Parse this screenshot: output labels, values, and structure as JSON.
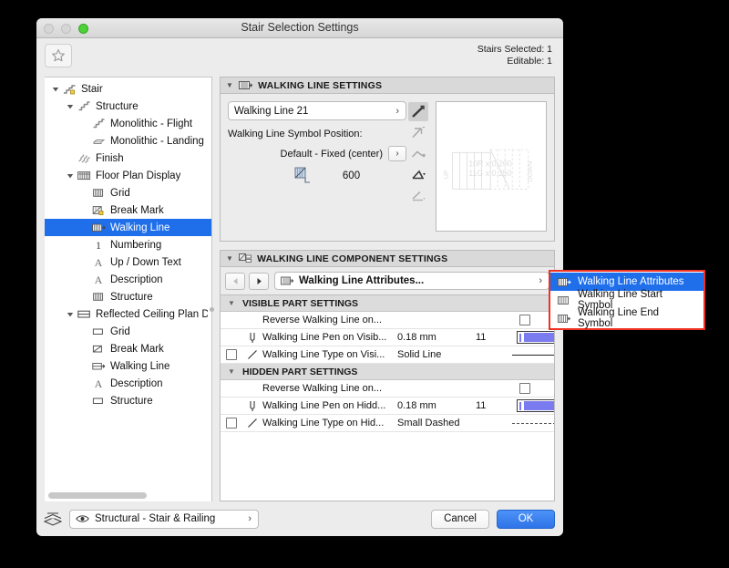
{
  "window": {
    "title": "Stair Selection Settings",
    "traffic_lights": [
      "close-disabled",
      "minimize-disabled",
      "zoom-green"
    ]
  },
  "toolbar": {
    "favorites_icon": "star-icon",
    "stairs_selected": "Stairs Selected: 1",
    "editable": "Editable: 1"
  },
  "sidebar": {
    "items": [
      {
        "label": "Stair",
        "depth": 0,
        "twisty": "down",
        "icon": "stair-icon",
        "selected": false
      },
      {
        "label": "Structure",
        "depth": 1,
        "twisty": "down",
        "icon": "structure-icon",
        "selected": false
      },
      {
        "label": "Monolithic - Flight",
        "depth": 2,
        "twisty": "none",
        "icon": "structure-icon",
        "selected": false
      },
      {
        "label": "Monolithic - Landing",
        "depth": 2,
        "twisty": "none",
        "icon": "landing-icon",
        "selected": false
      },
      {
        "label": "Finish",
        "depth": 1,
        "twisty": "none",
        "icon": "finish-icon",
        "selected": false
      },
      {
        "label": "Floor Plan Display",
        "depth": 1,
        "twisty": "down",
        "icon": "floorplan-icon",
        "selected": false
      },
      {
        "label": "Grid",
        "depth": 2,
        "twisty": "none",
        "icon": "grid-icon",
        "selected": false
      },
      {
        "label": "Break Mark",
        "depth": 2,
        "twisty": "none",
        "icon": "breakmark-icon",
        "selected": false
      },
      {
        "label": "Walking Line",
        "depth": 2,
        "twisty": "none",
        "icon": "walkingline-icon",
        "selected": true
      },
      {
        "label": "Numbering",
        "depth": 2,
        "twisty": "none",
        "icon": "numbering-icon",
        "selected": false
      },
      {
        "label": "Up / Down Text",
        "depth": 2,
        "twisty": "none",
        "icon": "text-icon",
        "selected": false
      },
      {
        "label": "Description",
        "depth": 2,
        "twisty": "none",
        "icon": "text-icon",
        "selected": false
      },
      {
        "label": "Structure",
        "depth": 2,
        "twisty": "none",
        "icon": "grid-icon",
        "selected": false
      },
      {
        "label": "Reflected Ceiling Plan Displ",
        "depth": 1,
        "twisty": "down",
        "icon": "rcp-icon",
        "selected": false
      },
      {
        "label": "Grid",
        "depth": 2,
        "twisty": "none",
        "icon": "rect-icon",
        "selected": false
      },
      {
        "label": "Break Mark",
        "depth": 2,
        "twisty": "none",
        "icon": "breakmark2-icon",
        "selected": false
      },
      {
        "label": "Walking Line",
        "depth": 2,
        "twisty": "none",
        "icon": "walkingline2-icon",
        "selected": false
      },
      {
        "label": "Description",
        "depth": 2,
        "twisty": "none",
        "icon": "text-icon",
        "selected": false
      },
      {
        "label": "Structure",
        "depth": 2,
        "twisty": "none",
        "icon": "rect-icon",
        "selected": false
      }
    ]
  },
  "walking_line_settings": {
    "header": "WALKING LINE SETTINGS",
    "header_icon": "walkingline-icon",
    "symbol_name": "Walking Line 21",
    "position_label": "Walking Line Symbol Position:",
    "position_value": "Default - Fixed (center)",
    "offset_icon": "symbol-offset-icon",
    "offset_value": "600",
    "line_styles": [
      {
        "name": "line-style-diagonal",
        "selected": true
      },
      {
        "name": "line-style-arrow",
        "selected": false
      },
      {
        "name": "line-style-dot",
        "selected": false
      },
      {
        "name": "line-style-angled",
        "selected": false
      },
      {
        "name": "line-style-flat",
        "selected": false
      }
    ],
    "preview": {
      "label_up": "UP",
      "label_down": "DOWN",
      "riser_text": "10R x 0.200",
      "going_text": "11G x 0.250"
    }
  },
  "component_settings": {
    "header": "WALKING LINE COMPONENT SETTINGS",
    "header_icon": "component-settings-icon",
    "prev_button": "prev-arrow",
    "next_button": "next-arrow",
    "selected_attribute": "Walking Line Attributes...",
    "groups": [
      {
        "title": "VISIBLE PART SETTINGS",
        "rows": [
          {
            "checkbox": false,
            "has_checkbox": false,
            "icon": "",
            "name": "Reverse Walking Line on...",
            "value": "",
            "number": "",
            "swatch": "checkbox",
            "checked": false
          },
          {
            "has_checkbox": false,
            "icon": "pen-icon",
            "name": "Walking Line Pen on Visib...",
            "value": "0.18 mm",
            "number": "11",
            "swatch": "pen"
          },
          {
            "has_checkbox": true,
            "checked": false,
            "icon": "linetype-icon",
            "name": "Walking Line Type on Visi...",
            "value": "Solid Line",
            "number": "",
            "swatch": "solid-line"
          }
        ]
      },
      {
        "title": "HIDDEN PART SETTINGS",
        "rows": [
          {
            "has_checkbox": false,
            "icon": "",
            "name": "Reverse Walking Line on...",
            "value": "",
            "number": "",
            "swatch": "checkbox",
            "checked": false
          },
          {
            "has_checkbox": false,
            "icon": "pen-icon",
            "name": "Walking Line Pen on Hidd...",
            "value": "0.18 mm",
            "number": "11",
            "swatch": "pen"
          },
          {
            "has_checkbox": true,
            "checked": false,
            "icon": "linetype-icon",
            "name": "Walking Line Type on Hid...",
            "value": "Small Dashed",
            "number": "",
            "swatch": "dashed-line"
          }
        ]
      }
    ]
  },
  "popup_menu": {
    "items": [
      {
        "label": "Walking Line Attributes",
        "icon": "walkingline-icon",
        "selected": true
      },
      {
        "label": "Walking Line Start Symbol",
        "icon": "walkingline-start-icon",
        "selected": false
      },
      {
        "label": "Walking Line End Symbol",
        "icon": "walkingline-end-icon",
        "selected": false
      }
    ],
    "highlight_color": "#ef3124",
    "selection_color": "#1f6feb"
  },
  "footer": {
    "layers_icon": "layers-icon",
    "eye_icon": "eye-icon",
    "layer_value": "Structural - Stair & Railing",
    "cancel_label": "Cancel",
    "ok_label": "OK"
  }
}
